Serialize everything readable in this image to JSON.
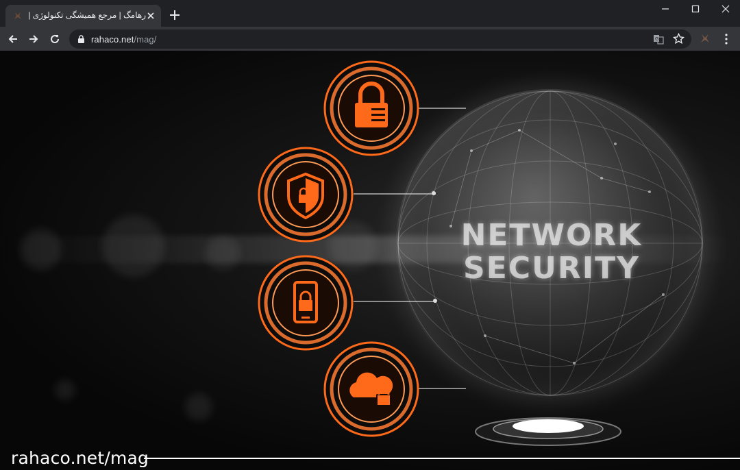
{
  "browser": {
    "tab": {
      "title": "رهامگ | مرجع همیشگی تکنولوژی |"
    },
    "address_bar": {
      "host": "rahaco.net",
      "path": "/mag/"
    },
    "icons": {
      "favicon": "rahaco-logo-icon",
      "close_tab": "close-icon",
      "new_tab": "plus-icon",
      "minimize": "minimize-icon",
      "maximize": "maximize-icon",
      "close_window": "close-icon",
      "back": "arrow-left-icon",
      "forward": "arrow-right-icon",
      "reload": "reload-icon",
      "lock": "lock-icon",
      "translate": "translate-icon",
      "bookmark": "star-icon",
      "extension": "extension-icon",
      "menu": "kebab-menu-icon"
    }
  },
  "hero": {
    "headline_line1": "NETWORK",
    "headline_line2": "SECURITY",
    "icons": [
      "padlock-icon",
      "shield-lock-icon",
      "phone-lock-icon",
      "cloud-lock-icon"
    ],
    "accent_color": "#ff6a1a"
  },
  "watermark": {
    "text": "rahaco.net/mag"
  }
}
